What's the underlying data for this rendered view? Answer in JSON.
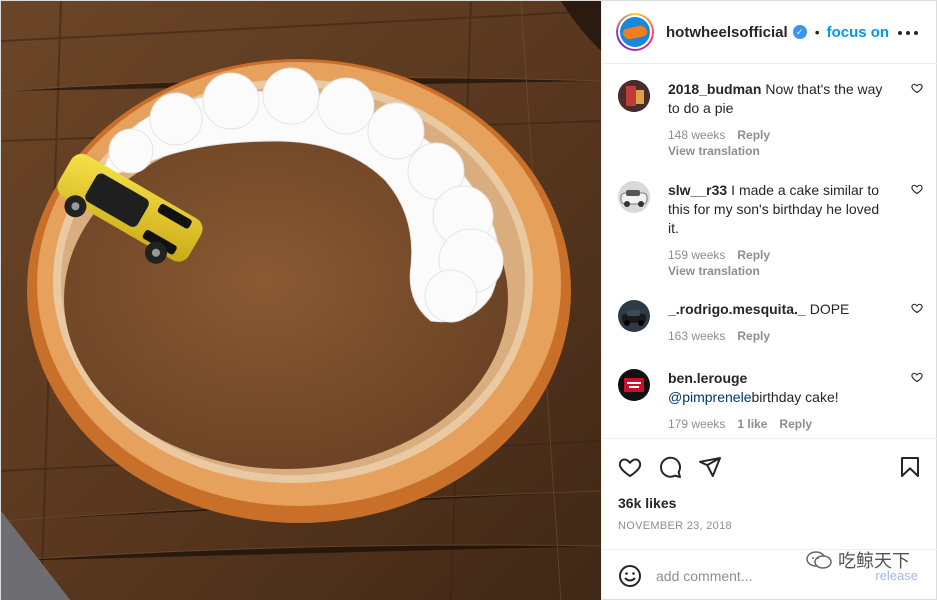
{
  "post": {
    "username": "hotwheelsofficial",
    "follow_label": "focus on",
    "separator": "•",
    "likes": "36k likes",
    "date": "NOVEMBER 23, 2018"
  },
  "comments": [
    {
      "username": "2018_budman",
      "text": "Now that's the way to do a pie",
      "time": "148 weeks",
      "reply": "Reply",
      "translate": "View translation"
    },
    {
      "username": "slw__r33",
      "text": "I made a cake similar to this for my son's birthday he loved it.",
      "time": "159 weeks",
      "reply": "Reply",
      "translate": "View translation"
    },
    {
      "username": "_.rodrigo.mesquita._",
      "text": "DOPE",
      "time": "163 weeks",
      "reply": "Reply"
    },
    {
      "username": "ben.lerouge",
      "mention": "@pimprenele",
      "text": "birthday cake!",
      "time": "179 weeks",
      "likes": "1 like",
      "reply": "Reply"
    }
  ],
  "add_comment": {
    "placeholder": "add comment..."
  },
  "watermark": {
    "text": "吃鲸天下",
    "sub": "release"
  },
  "icons": {
    "verified": "verified-badge-icon",
    "more": "more-options-icon",
    "like": "heart-icon",
    "comment": "comment-bubble-icon",
    "share": "paper-plane-icon",
    "save": "bookmark-icon",
    "emoji": "smiley-icon"
  },
  "colors": {
    "accent": "#0095f6",
    "text": "#262626",
    "muted": "#8e8e8e",
    "verified": "#3897f0"
  }
}
